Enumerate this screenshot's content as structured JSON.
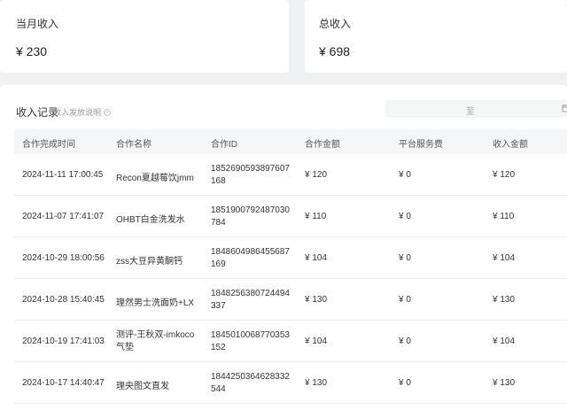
{
  "stats": {
    "month": {
      "label": "当月收入",
      "value": "¥ 230"
    },
    "total": {
      "label": "总收入",
      "value": "¥ 698"
    }
  },
  "records": {
    "title": "收入记录",
    "subtitle": "收入发放说明",
    "date_sep": "至",
    "columns": [
      "合作完成时间",
      "合作名称",
      "合作ID",
      "合作金额",
      "平台服务费",
      "收入金额"
    ],
    "rows": [
      {
        "time": "2024-11-11 17:00:45",
        "name": "Recon夏越莓饮jmm",
        "id": "1852690593897607168",
        "amount": "¥ 120",
        "fee": "¥ 0",
        "income": "¥ 120"
      },
      {
        "time": "2024-11-07 17:41:07",
        "name": "OHBT白金洗发水",
        "id": "1851900792487030784",
        "amount": "¥ 110",
        "fee": "¥ 0",
        "income": "¥ 110"
      },
      {
        "time": "2024-10-29 18:00:56",
        "name": "zss大豆异黄酮钙",
        "id": "1848604986455687169",
        "amount": "¥ 104",
        "fee": "¥ 0",
        "income": "¥ 104"
      },
      {
        "time": "2024-10-28 15:40:45",
        "name": "理然男士洗面奶+LX",
        "id": "1848256380724494337",
        "amount": "¥ 130",
        "fee": "¥ 0",
        "income": "¥ 130"
      },
      {
        "time": "2024-10-19 17:41:03",
        "name": "测评-王秋双-imkoco气垫",
        "id": "1845010068770353152",
        "amount": "¥ 104",
        "fee": "¥ 0",
        "income": "¥ 104"
      },
      {
        "time": "2024-10-17 14:40:47",
        "name": "理央图文直发",
        "id": "1844250364628332544",
        "amount": "¥ 130",
        "fee": "¥ 0",
        "income": "¥ 130"
      }
    ]
  },
  "icons": {
    "info": "info-icon",
    "calendar": "calendar-icon"
  }
}
